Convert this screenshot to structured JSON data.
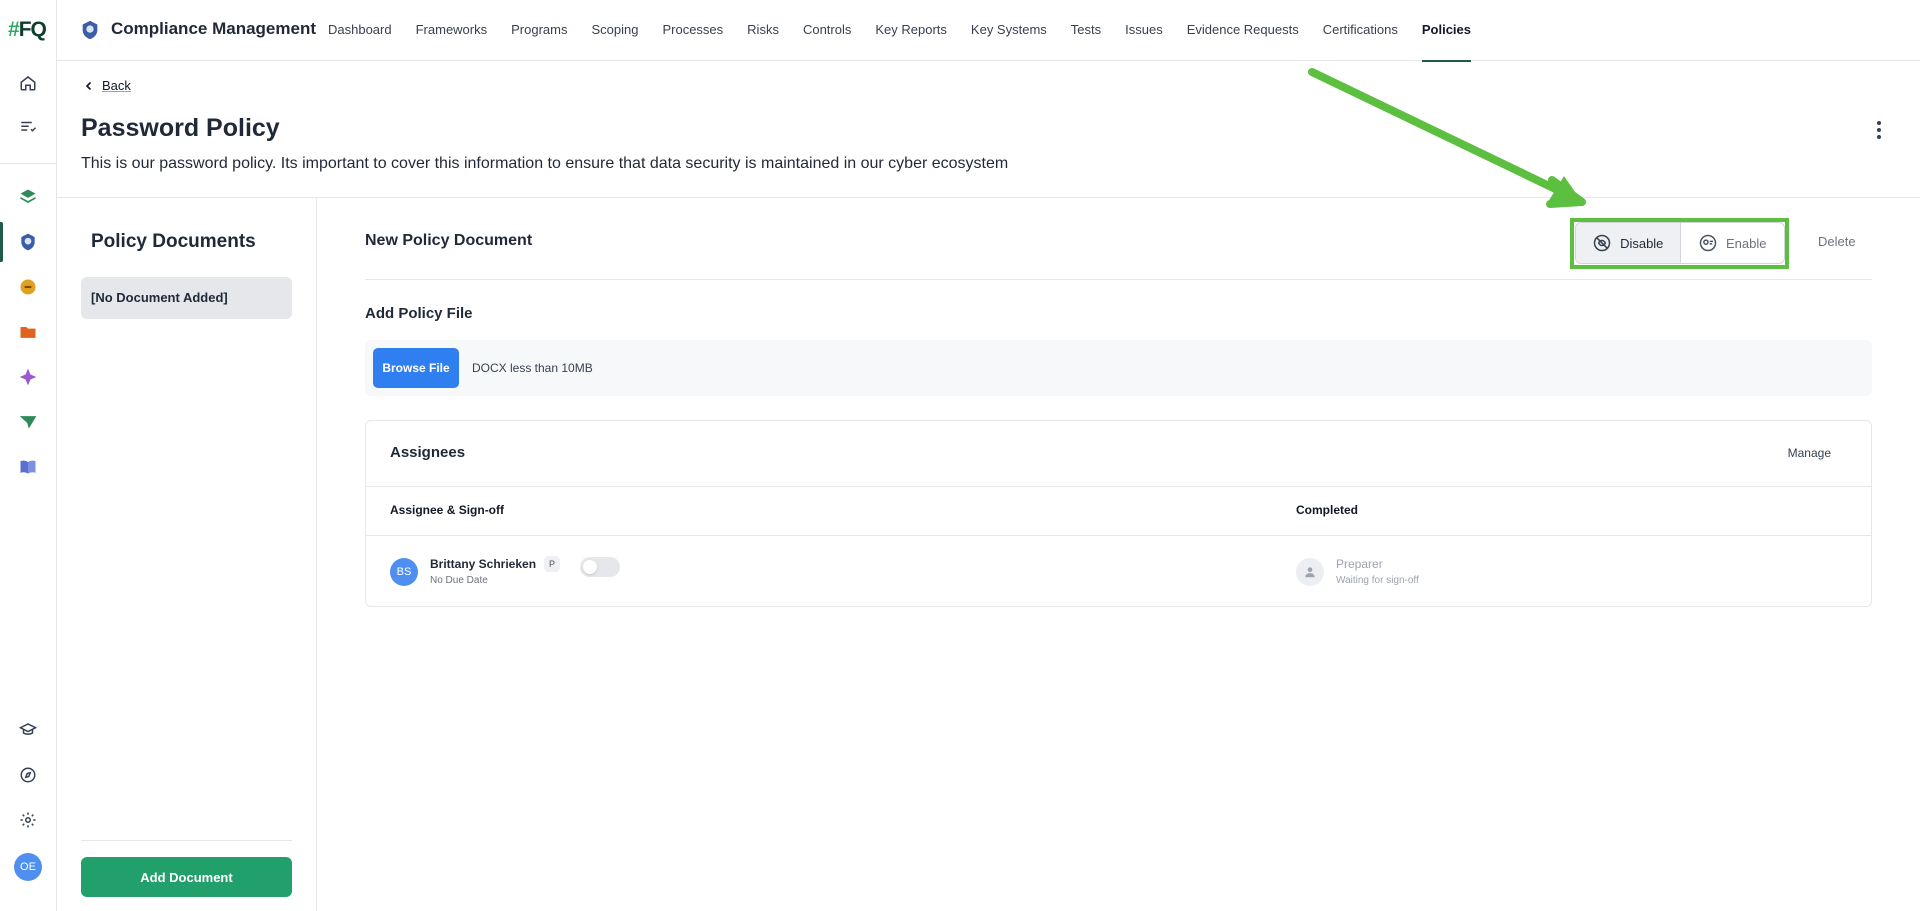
{
  "rail": {
    "logo": "FQ",
    "logo_hash": "#",
    "avatar_initials": "OE",
    "icons": [
      "home-icon",
      "list-filter-icon",
      "layers-icon",
      "shield-badge-icon",
      "link-coin-icon",
      "folder-icon",
      "star-icon",
      "send-icon",
      "book-icon",
      "graduation-cap-icon",
      "compass-icon",
      "gear-icon"
    ]
  },
  "topbar": {
    "app_title": "Compliance Management",
    "nav": [
      "Dashboard",
      "Frameworks",
      "Programs",
      "Scoping",
      "Processes",
      "Risks",
      "Controls",
      "Key Reports",
      "Key Systems",
      "Tests",
      "Issues",
      "Evidence Requests",
      "Certifications",
      "Policies"
    ],
    "active_nav": "Policies"
  },
  "header": {
    "back_label": "Back",
    "title": "Password Policy",
    "description": "This is our password policy. Its important to cover this information to ensure that data security is maintained in our cyber ecosystem"
  },
  "sidebar": {
    "title": "Policy Documents",
    "empty_item": "[No Document Added]",
    "add_button": "Add Document"
  },
  "main": {
    "title": "New Policy Document",
    "disable_label": "Disable",
    "enable_label": "Enable",
    "delete_label": "Delete",
    "add_file_title": "Add Policy File",
    "browse_label": "Browse File",
    "file_hint": "DOCX less than 10MB"
  },
  "assignees": {
    "title": "Assignees",
    "manage_label": "Manage",
    "col_assignee": "Assignee & Sign-off",
    "col_completed": "Completed",
    "rows": [
      {
        "initials": "BS",
        "name": "Brittany Schrieken",
        "role_badge": "P",
        "due": "No Due Date",
        "signoff_on": false,
        "completed_role": "Preparer",
        "completed_status": "Waiting for sign-off"
      }
    ]
  },
  "colors": {
    "accent_green": "#22a06b",
    "primary_blue": "#2f7ff0",
    "highlight_green": "#5dbf3f",
    "nav_active": "#1f5b4a"
  }
}
